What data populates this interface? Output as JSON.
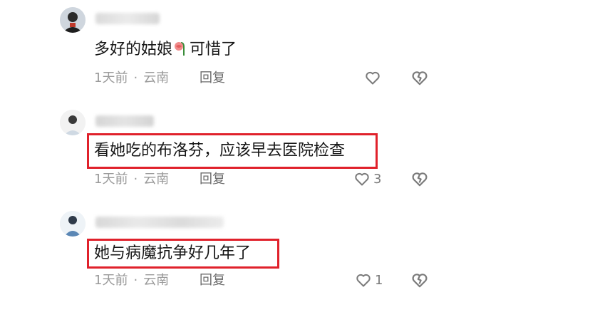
{
  "comments": [
    {
      "text_before": "多好的姑娘",
      "emoji": "wilted-rose",
      "text_after": "可惜了",
      "time": "1天前",
      "separator": "·",
      "location": "云南",
      "reply_label": "回复",
      "like_count": ""
    },
    {
      "text": "看她吃的布洛芬，应该早去医院检查",
      "time": "1天前",
      "separator": "·",
      "location": "云南",
      "reply_label": "回复",
      "like_count": "3",
      "highlighted": true
    },
    {
      "text": "她与病魔抗争好几年了",
      "time": "1天前",
      "separator": "·",
      "location": "云南",
      "reply_label": "回复",
      "like_count": "1",
      "highlighted": true
    }
  ],
  "colors": {
    "highlight": "#e0212b",
    "meta_text": "#9a9a9a",
    "icon": "#7a7a7a"
  },
  "icons": [
    "heart-outline-icon",
    "broken-heart-icon",
    "wilted-rose-emoji"
  ]
}
